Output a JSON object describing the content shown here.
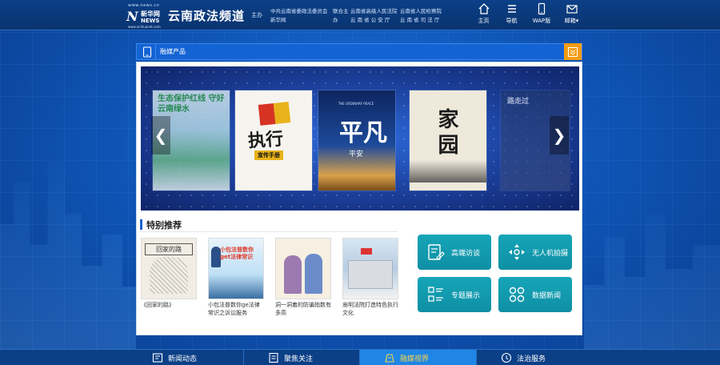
{
  "header": {
    "logo": {
      "url_top": "www.news.cn",
      "brand_cn": "新华网",
      "brand_en": "NEWS",
      "url_bottom": "www.xinhuanet.com"
    },
    "site_title": "云南政法频道",
    "sponsor_label": "主办",
    "sponsors": [
      "中共云南省委政法委员会",
      "新华网"
    ],
    "co_label": "联合主办",
    "co_sponsors": [
      "云南省高级人民法院",
      "云南省人民检察院",
      "云 南 省 公 安 厅",
      "云 南 省 司 法 厅"
    ],
    "nav": [
      {
        "label": "主页",
        "icon": "home-icon"
      },
      {
        "label": "导航",
        "icon": "menu-icon"
      },
      {
        "label": "WAP版",
        "icon": "mobile-icon"
      },
      {
        "label": "邮箱▾",
        "icon": "mail-icon"
      }
    ]
  },
  "section": {
    "title": "融媒产品",
    "icon": "tablet-icon",
    "toggle_icon": "chevron-down-icon"
  },
  "carousel": {
    "covers": [
      {
        "title": "生态保护红线 守好云南绿水"
      },
      {
        "title": "执行",
        "subtitle": "宣传手册"
      },
      {
        "title": "平凡",
        "subtitle": "平安",
        "en": "THE ORDINARY PEACE"
      },
      {
        "title": "家园"
      },
      {
        "title": "路走过"
      }
    ],
    "prev": "❮",
    "next": "❯"
  },
  "recommend": {
    "title": "特别推荐",
    "items": [
      {
        "caption": "《回家的路》",
        "thumb_text": "回家的路"
      },
      {
        "caption": "小包法普数你ge法律常识之诉讼服务",
        "thumb_text": "小包法普数你get法律常识"
      },
      {
        "caption": "洞一洞着的防骗指数有多高",
        "thumb_text": ""
      },
      {
        "caption": "嵩明法院打造特色执行文化",
        "thumb_text": ""
      }
    ]
  },
  "features": [
    {
      "label": "高端访谈",
      "icon": "interview-icon"
    },
    {
      "label": "无人机拍摄",
      "icon": "drone-icon"
    },
    {
      "label": "专题展示",
      "icon": "list-icon"
    },
    {
      "label": "数据新闻",
      "icon": "data-icon"
    }
  ],
  "bottom_tabs": [
    {
      "label": "新闻动态",
      "icon": "news-icon",
      "active": false
    },
    {
      "label": "聚焦关注",
      "icon": "focus-icon",
      "active": false
    },
    {
      "label": "融媒视界",
      "icon": "media-icon",
      "active": true
    },
    {
      "label": "法治服务",
      "icon": "service-icon",
      "active": false
    }
  ],
  "colors": {
    "accent": "#1463d4",
    "toggle": "#f39c12",
    "feature": "#16a5b8",
    "active_tab_text": "#f8d34a"
  }
}
